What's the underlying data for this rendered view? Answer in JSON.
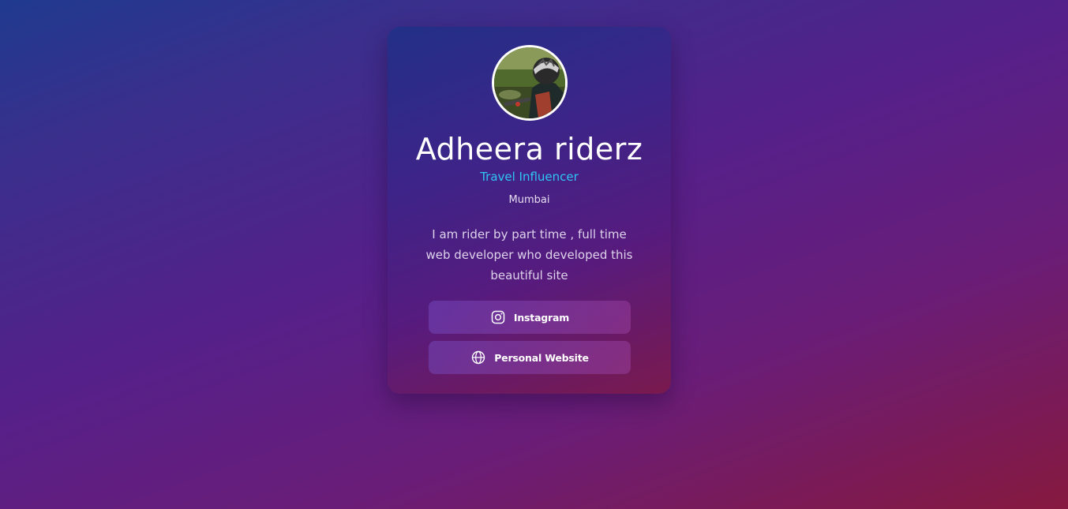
{
  "profile": {
    "name": "Adheera riderz",
    "role": "Travel Influencer",
    "location": "Mumbai",
    "bio": "I am rider by part time , full time web developer who developed this beautiful site",
    "avatar_icon": "avatar-photo"
  },
  "links": {
    "instagram": {
      "label": "Instagram",
      "icon": "instagram-icon"
    },
    "website": {
      "label": "Personal Website",
      "icon": "globe-icon"
    }
  },
  "colors": {
    "role_accent": "#2fc5f4",
    "text": "#ffffff"
  }
}
